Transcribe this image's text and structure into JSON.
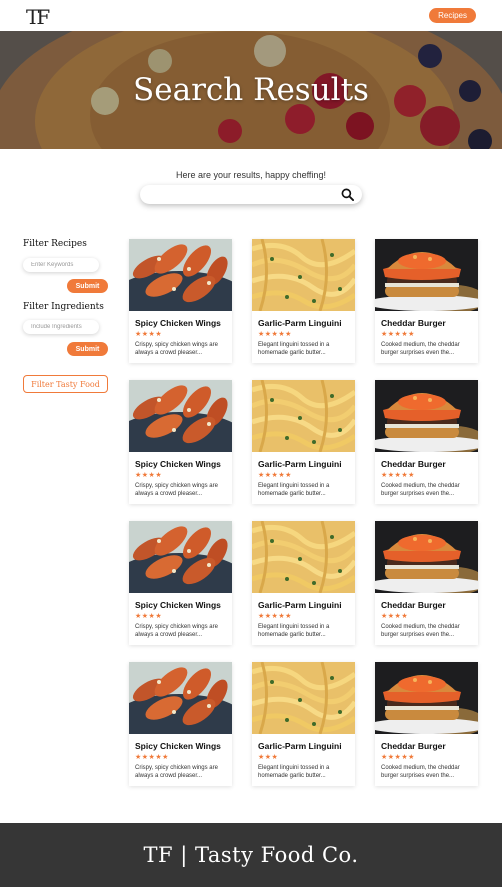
{
  "header": {
    "logo": "TF",
    "nav_button": "Recipes"
  },
  "hero": {
    "title": "Search Results"
  },
  "search": {
    "intro": "Here are your results, happy cheffing!",
    "value": ""
  },
  "sidebar": {
    "filter_recipes_title": "Filter Recipes",
    "keywords_placeholder": "Enter Keywords",
    "submit_label": "Submit",
    "filter_ingredients_title": "Filter Ingredients",
    "ingredients_placeholder": "Include Ingredients",
    "filter_tasty_label": "Filter Tasty Food"
  },
  "results": [
    {
      "title": "Spicy Chicken Wings",
      "rating": 4,
      "stars": "★★★★",
      "description": "Crispy, spicy chicken wings are always a crowd pleaser...",
      "image": "chicken-wings"
    },
    {
      "title": "Garlic-Parm Linguini",
      "rating": 5,
      "stars": "★★★★★",
      "description": "Elegant linguini tossed in a homemade garlic butter...",
      "image": "linguini"
    },
    {
      "title": "Cheddar Burger",
      "rating": 5,
      "stars": "★★★★★",
      "description": "Cooked medium, the cheddar burger surprises even the...",
      "image": "burger"
    },
    {
      "title": "Spicy Chicken Wings",
      "rating": 4,
      "stars": "★★★★",
      "description": "Crispy, spicy chicken wings are always a crowd pleaser...",
      "image": "chicken-wings"
    },
    {
      "title": "Garlic-Parm Linguini",
      "rating": 5,
      "stars": "★★★★★",
      "description": "Elegant linguini tossed in a homemade garlic butter...",
      "image": "linguini"
    },
    {
      "title": "Cheddar Burger",
      "rating": 5,
      "stars": "★★★★★",
      "description": "Cooked medium, the cheddar burger surprises even the...",
      "image": "burger"
    },
    {
      "title": "Spicy Chicken Wings",
      "rating": 4,
      "stars": "★★★★",
      "description": "Crispy, spicy chicken wings are always a crowd pleaser...",
      "image": "chicken-wings"
    },
    {
      "title": "Garlic-Parm Linguini",
      "rating": 5,
      "stars": "★★★★★",
      "description": "Elegant linguini tossed in a homemade garlic butter...",
      "image": "linguini"
    },
    {
      "title": "Cheddar Burger",
      "rating": 4,
      "stars": "★★★★",
      "description": "Cooked medium, the cheddar burger surprises even the...",
      "image": "burger"
    },
    {
      "title": "Spicy Chicken Wings",
      "rating": 5,
      "stars": "★★★★★",
      "description": "Crispy, spicy chicken wings are always a crowd pleaser...",
      "image": "chicken-wings"
    },
    {
      "title": "Garlic-Parm Linguini",
      "rating": 3,
      "stars": "★★★",
      "description": "Elegant linguini tossed in a homemade garlic butter...",
      "image": "linguini"
    },
    {
      "title": "Cheddar Burger",
      "rating": 5,
      "stars": "★★★★★",
      "description": "Cooked medium, the cheddar burger surprises even the...",
      "image": "burger"
    }
  ],
  "footer": {
    "brand": "TF  |  Tasty Food Co."
  },
  "colors": {
    "accent": "#f07a3a",
    "footer_bg": "#363636"
  }
}
